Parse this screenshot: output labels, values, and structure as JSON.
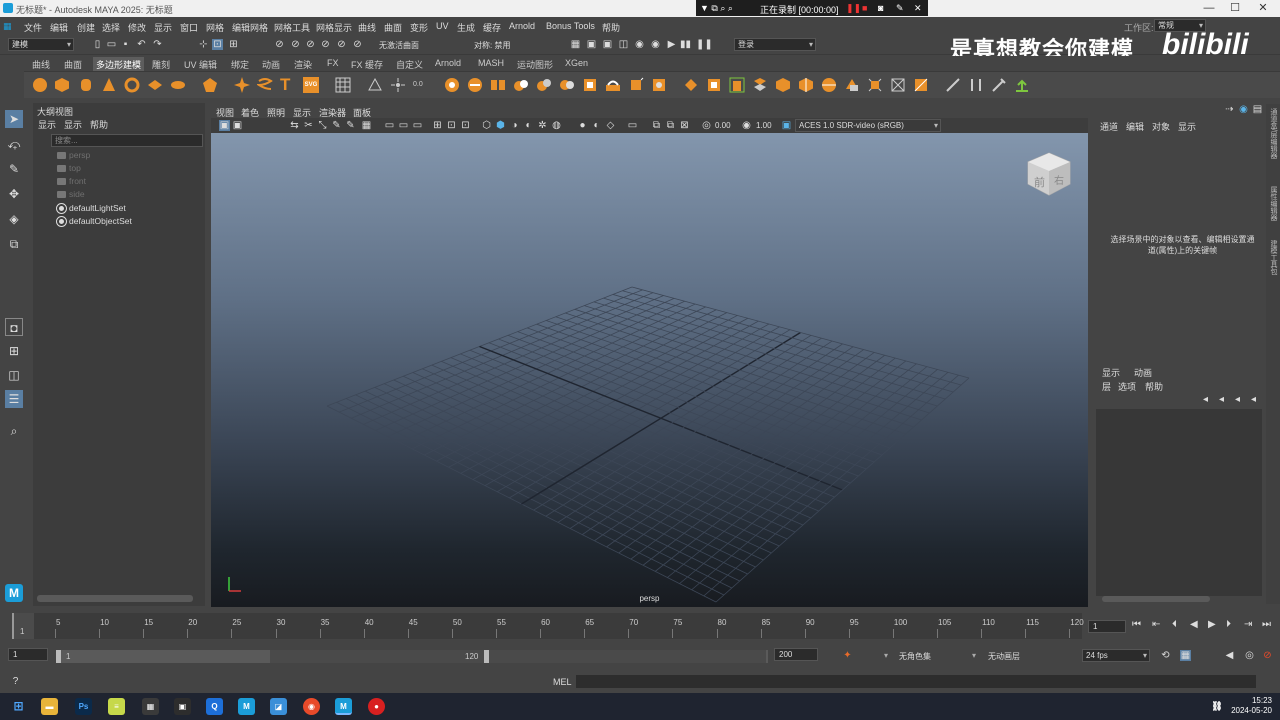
{
  "window": {
    "title": "无标题* - Autodesk MAYA 2025: 无标题",
    "minimize": "—",
    "maximize": "☐",
    "close": "✕"
  },
  "recorder": {
    "status": "正在录制 [00:00:00]"
  },
  "menubar": {
    "items": [
      "文件",
      "编辑",
      "创建",
      "选择",
      "修改",
      "显示",
      "窗口",
      "网格",
      "编辑网格",
      "网格工具",
      "网格显示",
      "曲线",
      "曲面",
      "变形",
      "UV",
      "生成",
      "缓存",
      "Arnold",
      "Bonus Tools",
      "帮助"
    ],
    "workspace_label": "工作区:",
    "workspace_value": "常规"
  },
  "statusline": {
    "mode": "建模",
    "live_surface": "无激活曲面",
    "symmetry": "对称: 禁用",
    "login": "登录"
  },
  "shelf": {
    "tabs": [
      "曲线",
      "曲面",
      "多边形建模",
      "雕刻",
      "UV 编辑",
      "绑定",
      "动画",
      "渲染",
      "FX",
      "FX 缓存",
      "自定义",
      "Arnold",
      "MASH",
      "运动图形",
      "XGen"
    ],
    "active_tab": "多边形建模",
    "svg_label": "SVG"
  },
  "outliner": {
    "title": "大纲视图",
    "menus": [
      "显示",
      "显示",
      "帮助"
    ],
    "search_placeholder": "搜索...",
    "items": [
      {
        "label": "persp",
        "kind": "camera"
      },
      {
        "label": "top",
        "kind": "camera"
      },
      {
        "label": "front",
        "kind": "camera"
      },
      {
        "label": "side",
        "kind": "camera"
      },
      {
        "label": "defaultLightSet",
        "kind": "set"
      },
      {
        "label": "defaultObjectSet",
        "kind": "set"
      }
    ]
  },
  "viewport": {
    "menus": [
      "视图",
      "着色",
      "照明",
      "显示",
      "渲染器",
      "面板"
    ],
    "exposure": "0.00",
    "gamma": "1.00",
    "color_space": "ACES 1.0 SDR-video (sRGB)",
    "camera_label": "persp",
    "viewcube_front": "前",
    "viewcube_right": "右"
  },
  "channelbox": {
    "menus": [
      "通道",
      "编辑",
      "对象",
      "显示"
    ],
    "hint": "选择场景中的对象以查看、编辑相设置通道(属性)上的关键帧",
    "side_tabs": [
      "通道盒/层编辑器",
      "属性编辑器",
      "建模工具包"
    ]
  },
  "layers": {
    "tabs": [
      "显示",
      "动画"
    ],
    "menus": [
      "层",
      "选项",
      "帮助"
    ]
  },
  "watermark": {
    "text": "是真想教会你建模",
    "logo": "bilibili"
  },
  "timeline": {
    "ticks": [
      "5",
      "10",
      "15",
      "20",
      "25",
      "30",
      "35",
      "40",
      "45",
      "50",
      "55",
      "60",
      "65",
      "70",
      "75",
      "80",
      "85",
      "90",
      "95",
      "100",
      "105",
      "110",
      "115",
      "120"
    ],
    "current_frame_marker": "1",
    "current_frame": "1",
    "start": "1",
    "range_start": "1",
    "range_end": "120",
    "end": "200",
    "character_set": "无角色集",
    "anim_layer": "无动画层",
    "fps": "24 fps"
  },
  "cmdline": {
    "lang": "MEL"
  },
  "taskbar": {
    "time": "15:23",
    "date": "2024-05-20"
  }
}
